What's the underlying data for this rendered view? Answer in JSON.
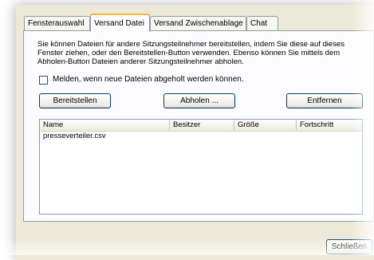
{
  "tabs": [
    {
      "label": "Fensterauswahl",
      "active": false
    },
    {
      "label": "Versand Datei",
      "active": true
    },
    {
      "label": "Versand Zwischenablage",
      "active": false
    },
    {
      "label": "Chat",
      "active": false
    }
  ],
  "description": "Sie können Dateien für andere Sitzungsteilnehmer bereitstellen, indem Sie diese auf dieses Fenster ziehen, oder den Bereitstellen-Button verwenden. Ebenso können Sie mittels dem Abholen-Button Dateien anderer Sitzungsteilnehmer abholen.",
  "notify_checkbox": {
    "label": "Melden, wenn neue Dateien abgeholt werden können.",
    "checked": false
  },
  "buttons": {
    "provide": "Bereitstellen",
    "fetch": "Abholen ...",
    "remove": "Entfernen",
    "close": "Schließen"
  },
  "file_list": {
    "columns": [
      "Name",
      "Besitzer",
      "Größe",
      "Fortschritt"
    ],
    "rows": [
      {
        "name": "presseverteiler.csv",
        "owner": "",
        "size": "",
        "progress": ""
      }
    ]
  }
}
